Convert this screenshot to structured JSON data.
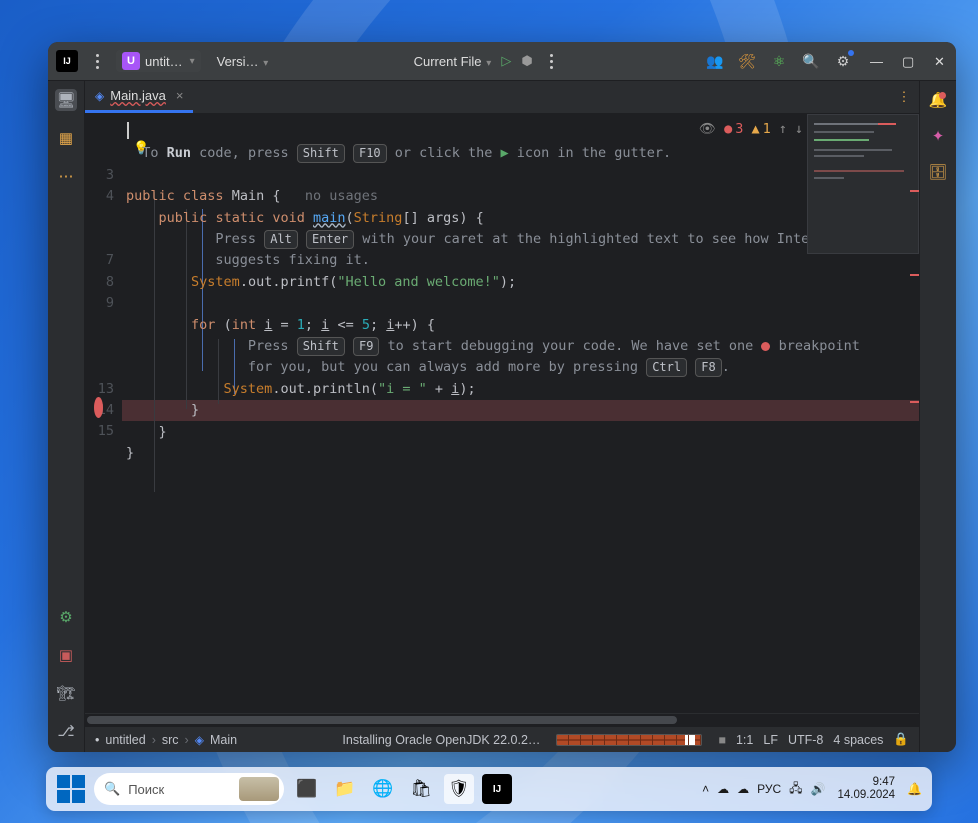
{
  "titlebar": {
    "logo_text": "IJ",
    "project_badge": "U",
    "project_name": "untit…",
    "vcs_label": "Versi…",
    "run_config": "Current File"
  },
  "tab": {
    "name": "Main.java",
    "close": "×"
  },
  "inspections": {
    "errors": "3",
    "warnings": "1"
  },
  "line_numbers": [
    "",
    "",
    "3",
    "4",
    "",
    "",
    "7",
    "8",
    "9",
    "",
    "",
    "",
    "13",
    "14",
    "15"
  ],
  "breakpoint_line_index": 11,
  "code": {
    "l1_a": "To ",
    "l1_b": "Run",
    "l1_c": " code, press ",
    "l1_shift": "Shift",
    "l1_f10": "F10",
    "l1_d": " or click the ",
    "l1_e": " icon in the gutter.",
    "l3_public": "public",
    "l3_class": "class",
    "l3_Main": "Main",
    "l3_brace": "{",
    "l3_hint": "no usages",
    "l4_public": "public",
    "l4_static": "static",
    "l4_void": "void",
    "l4_main": "main",
    "l4_p1": "(",
    "l4_String": "String",
    "l4_arr": "[]",
    "l4_args": "args",
    "l4_p2": ")",
    "l4_b": "{",
    "l5_a": "Press ",
    "l5_alt": "Alt",
    "l5_enter": "Enter",
    "l5_b": " with your caret at the highlighted text to see how IntelliJ IDEA",
    "l6_a": "suggests fixing it.",
    "l7_Sys": "System",
    "l7_out": ".out.",
    "l7_pl": "printf(",
    "l7_s": "\"Hello and welcome!\"",
    "l7_end": ");",
    "l9_for": "for",
    "l9_p1": "(",
    "l9_int": "int",
    "l9_i1": "i",
    "l9_eq": " = ",
    "l9_1": "1",
    "l9_s1": "; ",
    "l9_i2": "i",
    "l9_le": " <= ",
    "l9_5": "5",
    "l9_s2": "; ",
    "l9_i3": "i",
    "l9_pp": "++",
    "l9_p2": ")",
    "l9_b": "{",
    "l10_a": "Press ",
    "l10_shift": "Shift",
    "l10_f9": "F9",
    "l10_b": " to start debugging your code. We have set one ",
    "l10_c": " breakpoint",
    "l11_a": "for you, but you can always add more by pressing ",
    "l11_ctrl": "Ctrl",
    "l11_f8": "F8",
    "l11_dot": ".",
    "l12_Sys": "System",
    "l12_out": ".out.",
    "l12_pl": "println(",
    "l12_s": "\"i = \"",
    "l12_plus": " + ",
    "l12_i": "i",
    "l12_end": ");",
    "l13": "}",
    "l14": "}",
    "l15": "}"
  },
  "breadcrumbs": {
    "p0": "untitled",
    "p1": "src",
    "p2": "Main"
  },
  "status": {
    "task": "Installing Oracle OpenJDK 22.0.2…",
    "pos": "1:1",
    "eol": "LF",
    "enc": "UTF-8",
    "indent": "4 spaces"
  },
  "taskbar": {
    "search_placeholder": "Поиск",
    "lang": "РУС",
    "time": "9:47",
    "date": "14.09.2024"
  }
}
